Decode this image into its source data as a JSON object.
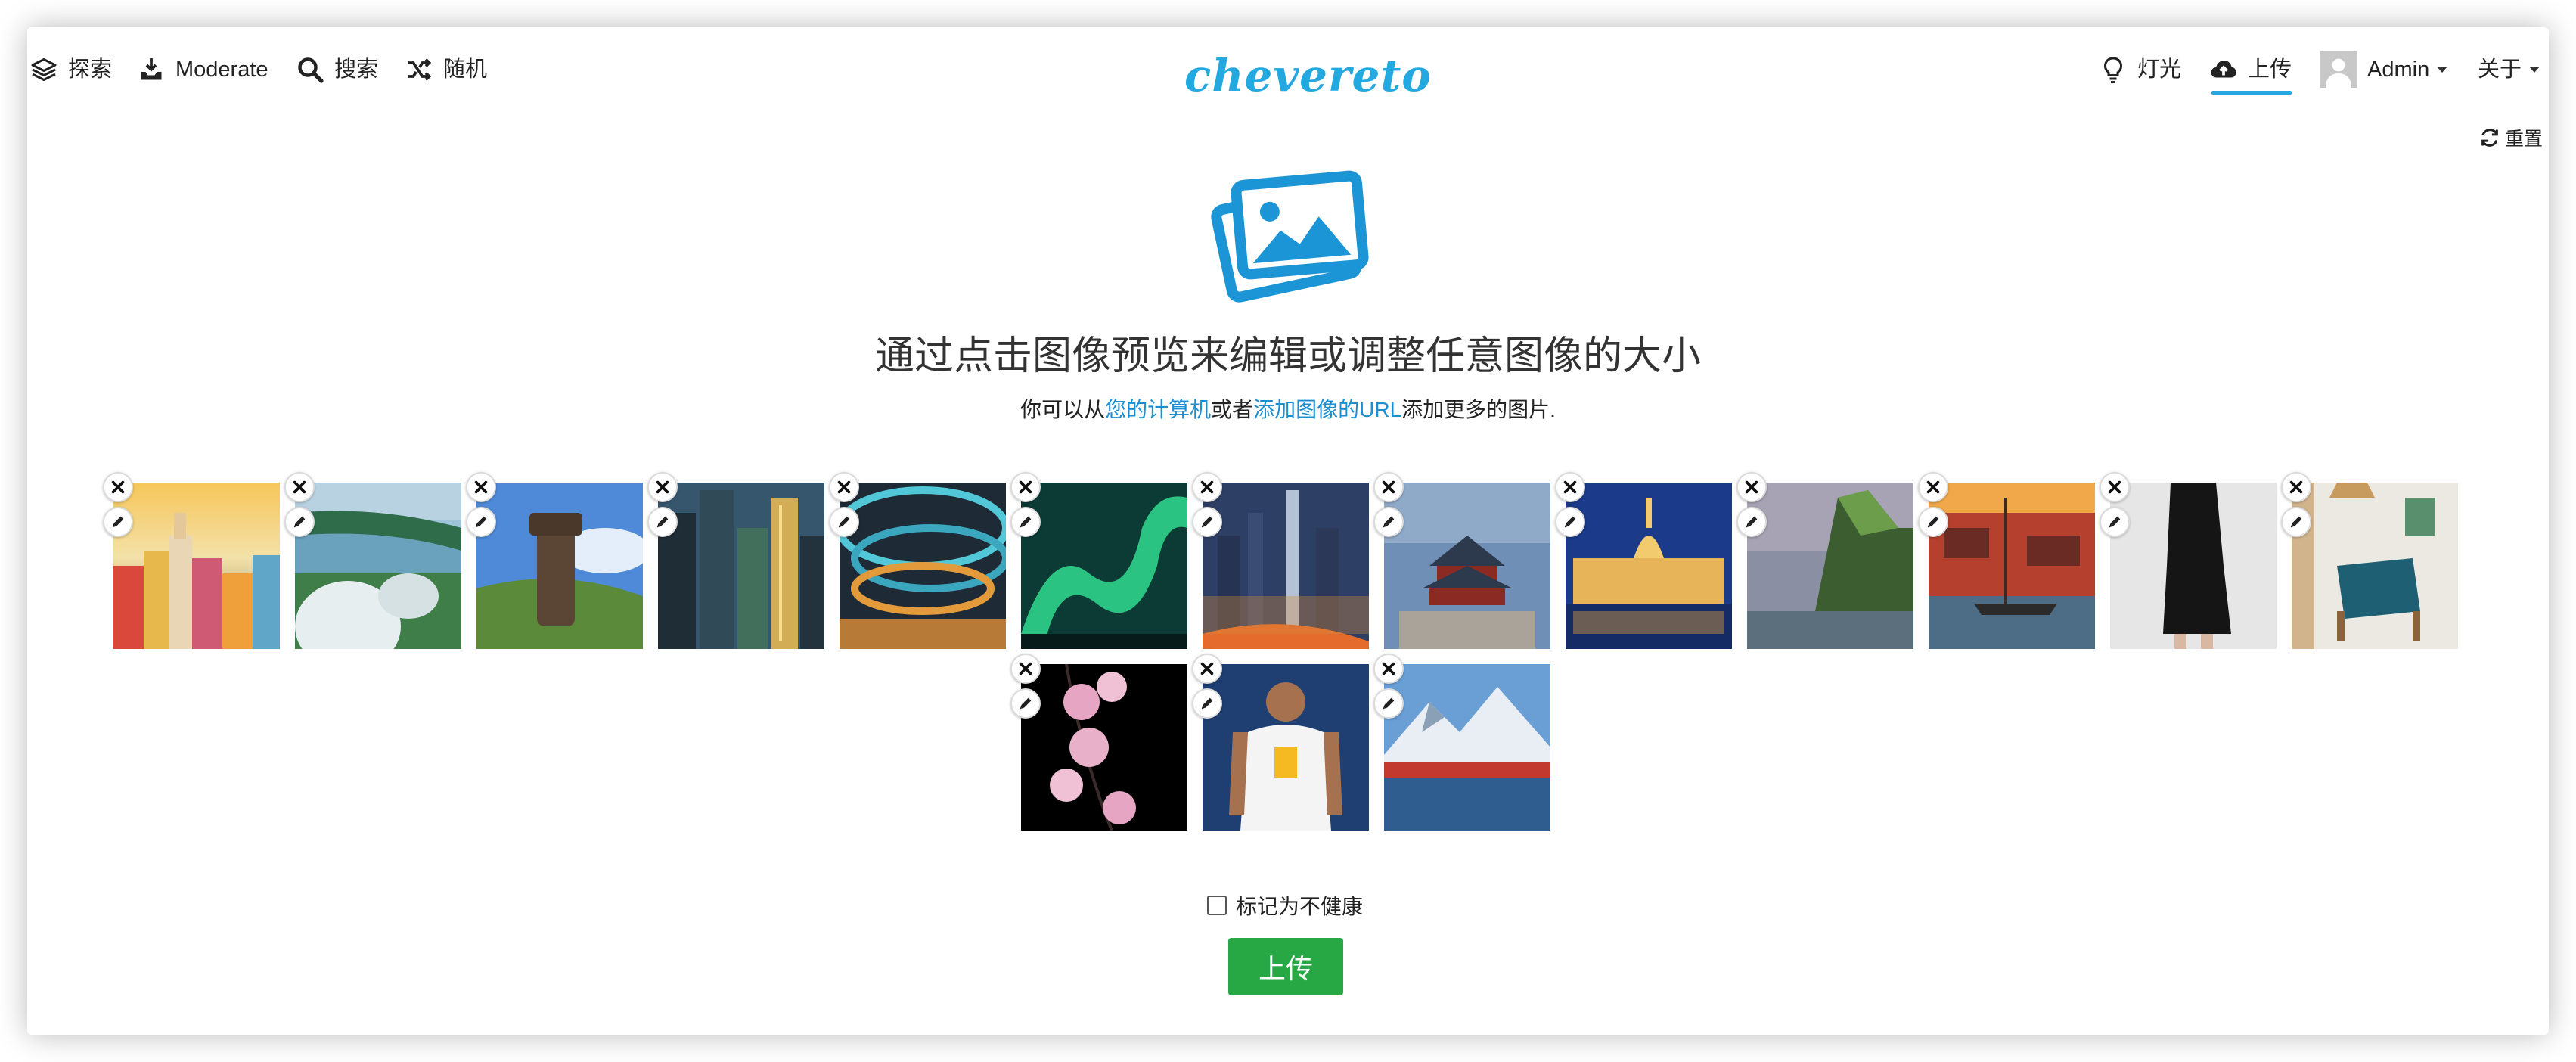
{
  "nav": {
    "explore": "探索",
    "moderate": "Moderate",
    "search": "搜索",
    "random": "随机",
    "logo": "chevereto",
    "lights": "灯光",
    "upload": "上传",
    "user": "Admin",
    "about": "关于"
  },
  "toolbar": {
    "reset": "重置"
  },
  "hero": {
    "headline": "通过点击图像预览来编辑或调整任意图像的大小",
    "sub_prefix": "你可以从",
    "sub_link1": "您的计算机",
    "sub_mid": "或者",
    "sub_link2": "添加图像的URL",
    "sub_suffix": "添加更多的图片."
  },
  "gallery": {
    "items": [
      "cinque-terre-houses",
      "gardens-by-the-bay",
      "easter-island-moai",
      "city-skyscrapers",
      "futuristic-architecture",
      "aurora-borealis",
      "shanghai-skyline",
      "temple-of-heaven",
      "budapest-parliament-night",
      "faroe-cliffs",
      "ship-by-harbor-sunset",
      "black-dress-model",
      "interior-blue-chair",
      "pink-orchid",
      "basketball-player",
      "snowy-mountain-harbor"
    ]
  },
  "form": {
    "nsfw_label": "标记为不健康",
    "submit": "上传"
  },
  "colors": {
    "accent": "#23a8e0",
    "link": "#1b8fd1",
    "submit": "#28a745"
  },
  "icons": [
    "layers-icon",
    "inbox-tray-icon",
    "search-icon",
    "shuffle-icon",
    "lightbulb-icon",
    "cloud-upload-icon",
    "user-avatar-icon",
    "refresh-icon",
    "images-icon",
    "close-icon",
    "pencil-icon"
  ]
}
